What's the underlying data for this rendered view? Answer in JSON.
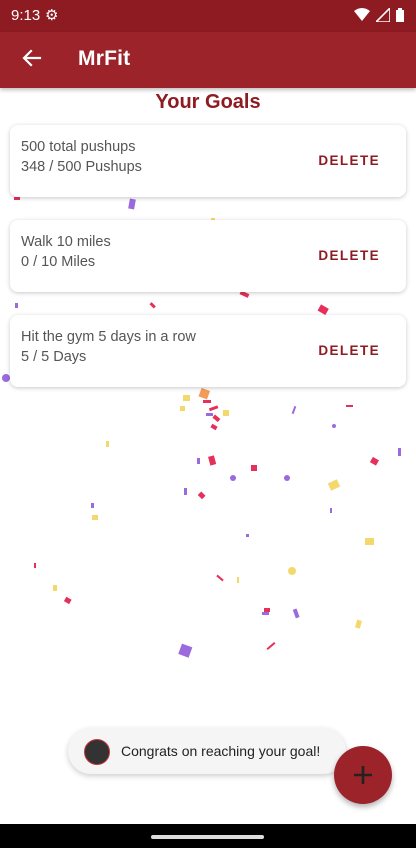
{
  "status_bar": {
    "time": "9:13"
  },
  "app_bar": {
    "title": "MrFit"
  },
  "page": {
    "title": "Your Goals"
  },
  "goals": [
    {
      "name": "500 total pushups",
      "progress": "348 / 500 Pushups",
      "action": "DELETE"
    },
    {
      "name": "Walk 10 miles",
      "progress": "0 / 10 Miles",
      "action": "DELETE"
    },
    {
      "name": "Hit the gym 5 days in a row",
      "progress": "5 / 5 Days",
      "action": "DELETE"
    }
  ],
  "snackbar": {
    "message": "Congrats on reaching your goal!"
  },
  "colors": {
    "primary": "#9c232a",
    "status_bar": "#8e1b22",
    "accent_text": "#8e1b22"
  },
  "icons": {
    "back": "arrow-left-icon",
    "fab": "plus-icon",
    "status": [
      "settings-icon",
      "wifi-icon",
      "signal-icon",
      "battery-icon"
    ]
  }
}
